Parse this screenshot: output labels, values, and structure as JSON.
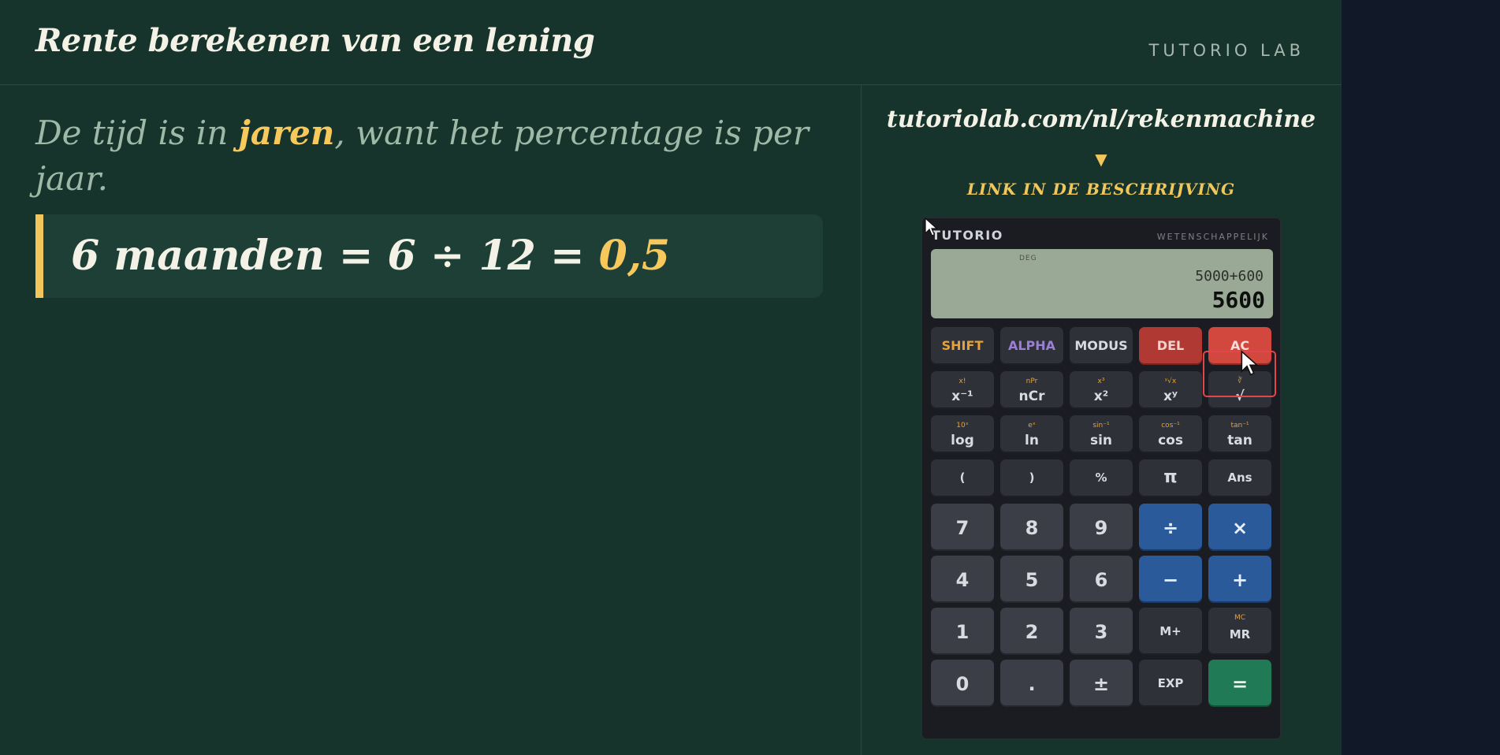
{
  "header": {
    "title": "Rente berekenen van een lening",
    "brand": "TUTORIO LAB"
  },
  "lesson": {
    "line_before": "De tijd is in ",
    "highlight": "jaren",
    "line_after": ", want het percentage is per jaar."
  },
  "equation": {
    "text": "6 maanden = 6 ÷ 12 = ",
    "result": "0,5"
  },
  "promo": {
    "url": "tutoriolab.com/nl/rekenmachine",
    "arrow": "▼",
    "link_text": "LINK IN DE BESCHRIJVING"
  },
  "calculator": {
    "brand": "TUTORIO",
    "model": "WETENSCHAPPELIJK",
    "display": {
      "mode": "DEG",
      "expression": "5000+600",
      "result": "5600"
    },
    "keys": {
      "shift": "SHIFT",
      "alpha": "ALPHA",
      "mode": "MODUS",
      "del": "DEL",
      "ac": "AC",
      "inv": {
        "main": "x⁻¹",
        "sec": "x!"
      },
      "ncr": {
        "main": "nCr",
        "sec": "nPr"
      },
      "sq": {
        "main": "x²",
        "sec": "x³"
      },
      "pow": {
        "main": "xʸ",
        "sec": "ʸ√x"
      },
      "sqrt": {
        "main": "√",
        "sec": "∛"
      },
      "log": {
        "main": "log",
        "sec": "10ˣ"
      },
      "ln": {
        "main": "ln",
        "sec": "eˣ"
      },
      "sin": {
        "main": "sin",
        "sec": "sin⁻¹"
      },
      "cos": {
        "main": "cos",
        "sec": "cos⁻¹"
      },
      "tan": {
        "main": "tan",
        "sec": "tan⁻¹"
      },
      "lparen": "(",
      "rparen": ")",
      "percent": "%",
      "pi": "π",
      "ans": "Ans",
      "n7": "7",
      "n8": "8",
      "n9": "9",
      "div": "÷",
      "mul": "×",
      "n4": "4",
      "n5": "5",
      "n6": "6",
      "minus": "−",
      "plus": "+",
      "n1": "1",
      "n2": "2",
      "n3": "3",
      "mplus": "M+",
      "mr": {
        "main": "MR",
        "sec": "MC"
      },
      "n0": "0",
      "dot": ".",
      "neg": "±",
      "exp": "EXP",
      "equals": "="
    }
  },
  "colors": {
    "board": "#16342b",
    "accent": "#f7c85c",
    "focus": "#e0474c"
  }
}
